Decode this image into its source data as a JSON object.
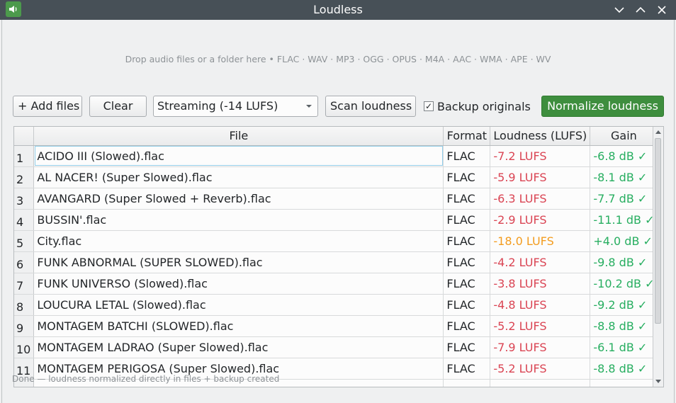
{
  "window": {
    "title": "Loudless",
    "accent": "#3e8e3e"
  },
  "drop_zone": {
    "text": "Drop audio files or a folder here  •  FLAC · WAV · MP3 · OGG · OPUS · M4A · AAC · WMA · APE · WV"
  },
  "toolbar": {
    "add_files_label": "+ Add files",
    "clear_label": "Clear",
    "preset_value": "Streaming (-14 LUFS)",
    "scan_label": "Scan loudness",
    "backup_label": "Backup originals",
    "backup_checked": true,
    "normalize_label": "Normalize loudness"
  },
  "table": {
    "headers": [
      "File",
      "Format",
      "Loudness (LUFS)",
      "Gain"
    ],
    "rows": [
      {
        "n": "1",
        "file": "ACIDO III (Slowed).flac",
        "format": "FLAC",
        "loudness": "-7.2 LUFS",
        "gain": "-6.8 dB ✓"
      },
      {
        "n": "2",
        "file": "AL NACER! (Super Slowed).flac",
        "format": "FLAC",
        "loudness": "-5.9 LUFS",
        "gain": "-8.1 dB ✓"
      },
      {
        "n": "3",
        "file": "AVANGARD (Super Slowed + Reverb).flac",
        "format": "FLAC",
        "loudness": "-6.3 LUFS",
        "gain": "-7.7 dB ✓"
      },
      {
        "n": "4",
        "file": "BUSSIN'.flac",
        "format": "FLAC",
        "loudness": "-2.9 LUFS",
        "gain": "-11.1 dB ✓"
      },
      {
        "n": "5",
        "file": "City.flac",
        "format": "FLAC",
        "loudness": "-18.0 LUFS",
        "gain": "+4.0 dB ✓"
      },
      {
        "n": "6",
        "file": "FUNK ABNORMAL (SUPER SLOWED).flac",
        "format": "FLAC",
        "loudness": "-4.2 LUFS",
        "gain": "-9.8 dB ✓"
      },
      {
        "n": "7",
        "file": "FUNK UNIVERSO (Slowed).flac",
        "format": "FLAC",
        "loudness": "-3.8 LUFS",
        "gain": "-10.2 dB ✓"
      },
      {
        "n": "8",
        "file": "LOUCURA LETAL (Slowed).flac",
        "format": "FLAC",
        "loudness": "-4.8 LUFS",
        "gain": "-9.2 dB ✓"
      },
      {
        "n": "9",
        "file": "MONTAGEM BATCHI (SLOWED).flac",
        "format": "FLAC",
        "loudness": "-5.2 LUFS",
        "gain": "-8.8 dB ✓"
      },
      {
        "n": "10",
        "file": "MONTAGEM LADRAO (Super Slowed).flac",
        "format": "FLAC",
        "loudness": "-7.9 LUFS",
        "gain": "-6.1 dB ✓"
      },
      {
        "n": "11",
        "file": "MONTAGEM PERIGOSA (Super Slowed).flac",
        "format": "FLAC",
        "loudness": "-5.2 LUFS",
        "gain": "-8.8 dB ✓"
      }
    ]
  },
  "status": {
    "text": "Done — loudness normalized directly in files + backup created"
  }
}
